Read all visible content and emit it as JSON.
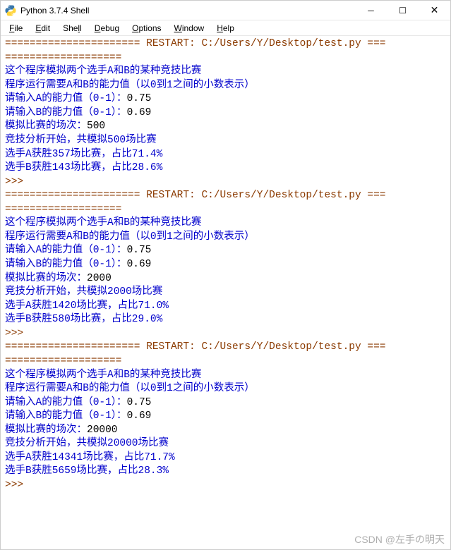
{
  "window": {
    "title": "Python 3.7.4 Shell"
  },
  "menu": {
    "file": "File",
    "edit": "Edit",
    "shell": "Shell",
    "debug": "Debug",
    "options": "Options",
    "window": "Window",
    "help": "Help"
  },
  "runs": [
    {
      "restart_line": "====================== RESTART: C:/Users/Y/Desktop/test.py ===",
      "restart_line2": "===================",
      "intro1": "这个程序模拟两个选手A和B的某种竞技比赛",
      "intro2": "程序运行需要A和B的能力值（以0到1之间的小数表示）",
      "prompt_a": "请输入A的能力值（0-1）：",
      "val_a": "0.75",
      "prompt_b": "请输入B的能力值（0-1）：",
      "val_b": "0.69",
      "prompt_n": "模拟比赛的场次：",
      "val_n": "500",
      "start": "竞技分析开始，共模拟500场比赛",
      "res_a": "选手A获胜357场比赛，占比71.4%",
      "res_b": "选手B获胜143场比赛，占比28.6%",
      "prompt_end": ">>>"
    },
    {
      "restart_line": "====================== RESTART: C:/Users/Y/Desktop/test.py ===",
      "restart_line2": "===================",
      "intro1": "这个程序模拟两个选手A和B的某种竞技比赛",
      "intro2": "程序运行需要A和B的能力值（以0到1之间的小数表示）",
      "prompt_a": "请输入A的能力值（0-1）：",
      "val_a": "0.75",
      "prompt_b": "请输入B的能力值（0-1）：",
      "val_b": "0.69",
      "prompt_n": "模拟比赛的场次：",
      "val_n": "2000",
      "start": "竞技分析开始，共模拟2000场比赛",
      "res_a": "选手A获胜1420场比赛，占比71.0%",
      "res_b": "选手B获胜580场比赛，占比29.0%",
      "prompt_end": ">>>"
    },
    {
      "restart_line": "====================== RESTART: C:/Users/Y/Desktop/test.py ===",
      "restart_line2": "===================",
      "intro1": "这个程序模拟两个选手A和B的某种竞技比赛",
      "intro2": "程序运行需要A和B的能力值（以0到1之间的小数表示）",
      "prompt_a": "请输入A的能力值（0-1）：",
      "val_a": "0.75",
      "prompt_b": "请输入B的能力值（0-1）：",
      "val_b": "0.69",
      "prompt_n": "模拟比赛的场次：",
      "val_n": "20000",
      "start": "竞技分析开始，共模拟20000场比赛",
      "res_a": "选手A获胜14341场比赛，占比71.7%",
      "res_b": "选手B获胜5659场比赛，占比28.3%",
      "prompt_end": ">>>"
    }
  ],
  "watermark": "CSDN @左手の明天"
}
